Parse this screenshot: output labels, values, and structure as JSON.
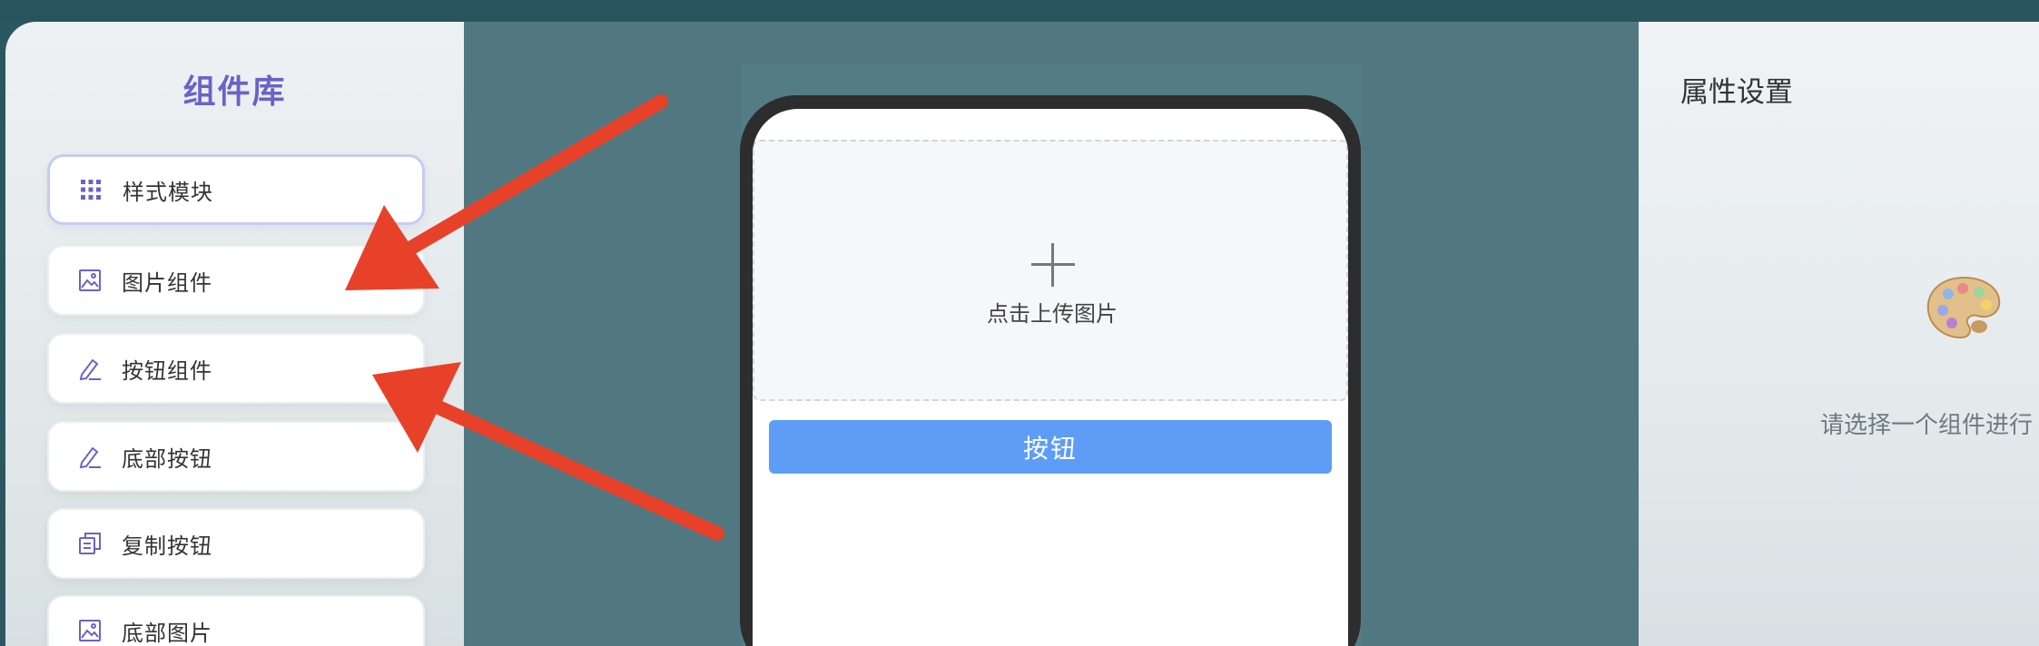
{
  "left_panel": {
    "title": "组件库",
    "items": [
      {
        "label": "样式模块",
        "icon": "grid-icon"
      },
      {
        "label": "图片组件",
        "icon": "image-icon"
      },
      {
        "label": "按钮组件",
        "icon": "pencil-icon"
      },
      {
        "label": "底部按钮",
        "icon": "pencil-icon"
      },
      {
        "label": "复制按钮",
        "icon": "copy-icon"
      },
      {
        "label": "底部图片",
        "icon": "image-icon"
      }
    ]
  },
  "canvas": {
    "upload_text": "点击上传图片",
    "button_label": "按钮"
  },
  "right_panel": {
    "title": "属性设置",
    "hint": "请选择一个组件进行",
    "icon": "palette-icon"
  },
  "colors": {
    "accent": "#6a63c6",
    "button": "#5d9df5",
    "arrow": "#e8412a",
    "canvas_bg": "#517880"
  }
}
